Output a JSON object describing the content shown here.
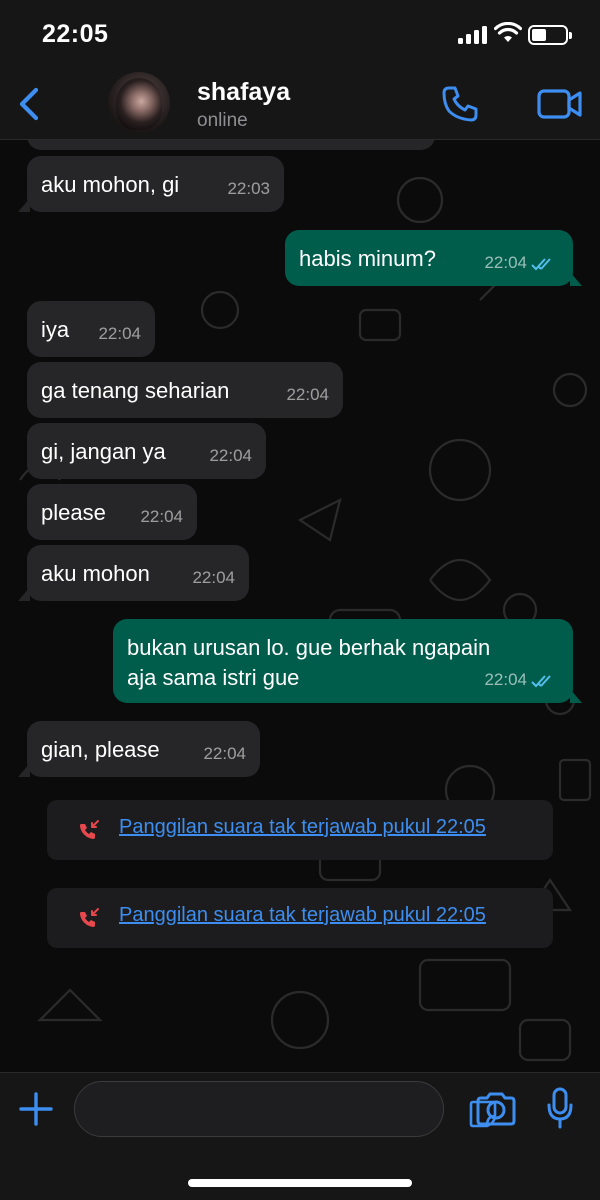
{
  "status_bar": {
    "time": "22:05"
  },
  "header": {
    "contact_name": "shafaya",
    "contact_status": "online"
  },
  "messages": [
    {
      "direction": "in",
      "text": "aku mohon, gi",
      "time": "22:03"
    },
    {
      "direction": "out",
      "text": "habis minum?",
      "time": "22:04",
      "read": true
    },
    {
      "direction": "in",
      "text": "iya",
      "time": "22:04"
    },
    {
      "direction": "in",
      "text": "ga tenang seharian",
      "time": "22:04"
    },
    {
      "direction": "in",
      "text": "gi, jangan ya",
      "time": "22:04"
    },
    {
      "direction": "in",
      "text": "please",
      "time": "22:04"
    },
    {
      "direction": "in",
      "text": "aku mohon",
      "time": "22:04"
    },
    {
      "direction": "out",
      "text_line1": "bukan urusan lo. gue berhak ngapain",
      "text_line2": "aja sama istri gue",
      "time": "22:04",
      "read": true
    },
    {
      "direction": "in",
      "text": "gian, please",
      "time": "22:04"
    }
  ],
  "missed_calls": [
    {
      "text": "Panggilan suara tak terjawab pukul 22:05"
    },
    {
      "text": "Panggilan suara tak terjawab pukul 22:05"
    }
  ],
  "input": {
    "placeholder": ""
  },
  "colors": {
    "accent": "#3d8ef0",
    "outgoing_bubble": "#005c4b",
    "incoming_bubble": "#262628",
    "missed_call_icon": "#e5484d",
    "read_ticks": "#53bdeb"
  }
}
